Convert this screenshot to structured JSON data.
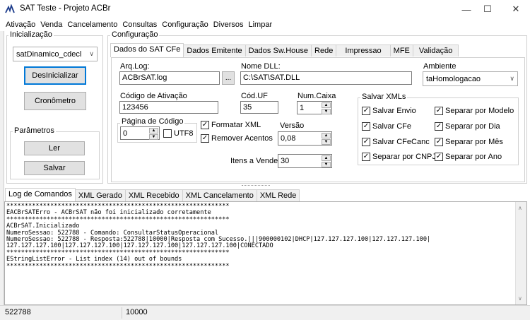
{
  "window": {
    "title": "SAT Teste - Projeto ACBr"
  },
  "menu": [
    "Ativação",
    "Venda",
    "Cancelamento",
    "Consultas",
    "Configuração",
    "Diversos",
    "Limpar"
  ],
  "inicializacao": {
    "label": "Inicialização",
    "modelo": "satDinamico_cdecl",
    "btn_inicializar": "DesInicializar",
    "btn_cronometro": "Cronômetro"
  },
  "parametros": {
    "label": "Parâmetros",
    "btn_ler": "Ler",
    "btn_salvar": "Salvar"
  },
  "configuracao": {
    "label": "Configuração",
    "tabs": [
      "Dados do SAT CFe",
      "Dados Emitente",
      "Dados Sw.House",
      "Rede",
      "Impressao",
      "MFE",
      "Validação"
    ],
    "arq_log_label": "Arq.Log:",
    "arq_log_value": "ACBrSAT.log",
    "browse_label": "...",
    "nome_dll_label": "Nome DLL:",
    "nome_dll_value": "C:\\SAT\\SAT.DLL",
    "ambiente_label": "Ambiente",
    "ambiente_value": "taHomologacao",
    "codigo_ativacao_label": "Código de Ativação",
    "codigo_ativacao_value": "123456",
    "cod_uf_label": "Cód.UF",
    "cod_uf_value": "35",
    "num_caixa_label": "Num.Caixa",
    "num_caixa_value": "1",
    "pagina_codigo_label": "Página de Código",
    "pagina_codigo_value": "0",
    "utf8_label": "UTF8",
    "formatar_xml_label": "Formatar XML",
    "remover_acentos_label": "Remover Acentos",
    "versao_label": "Versão",
    "versao_value": "0,08",
    "itens_vender_label": "Itens a Vender:",
    "itens_vender_value": "30"
  },
  "salvar_xmls": {
    "label": "Salvar XMLs",
    "salvar_envio": "Salvar Envio",
    "salvar_cfe": "Salvar CFe",
    "salvar_cfecanc": "Salvar CFeCanc",
    "separar_cnpj": "Separar por CNPJ",
    "separar_modelo": "Separar por Modelo",
    "separar_dia": "Separar por Dia",
    "separar_mes": "Separar por Mês",
    "separar_ano": "Separar por Ano"
  },
  "bottom_tabs": [
    "Log de Comandos",
    "XML Gerado",
    "XML Recebido",
    "XML Cancelamento",
    "XML Rede"
  ],
  "log_text": "*************************************************************\nEACBrSATErro - ACBrSAT não foi inicializado corretamente\n*************************************************************\nACBrSAT.Inicializado\nNumeroSessao: 522788 - Comando: ConsultarStatusOperacional\nNumeroSessao: 522788 - Resposta:522788|10000|Resposta com Sucesso.|||900000102|DHCP|127.127.127.100|127.127.127.100|\n127.127.127.100|127.127.127.100|127.127.127.100|127.127.127.100|CONECTADO\n*************************************************************\nEStringListError - List index (14) out of bounds\n*************************************************************",
  "status": {
    "sessao": "522788",
    "codigo": "10000"
  }
}
